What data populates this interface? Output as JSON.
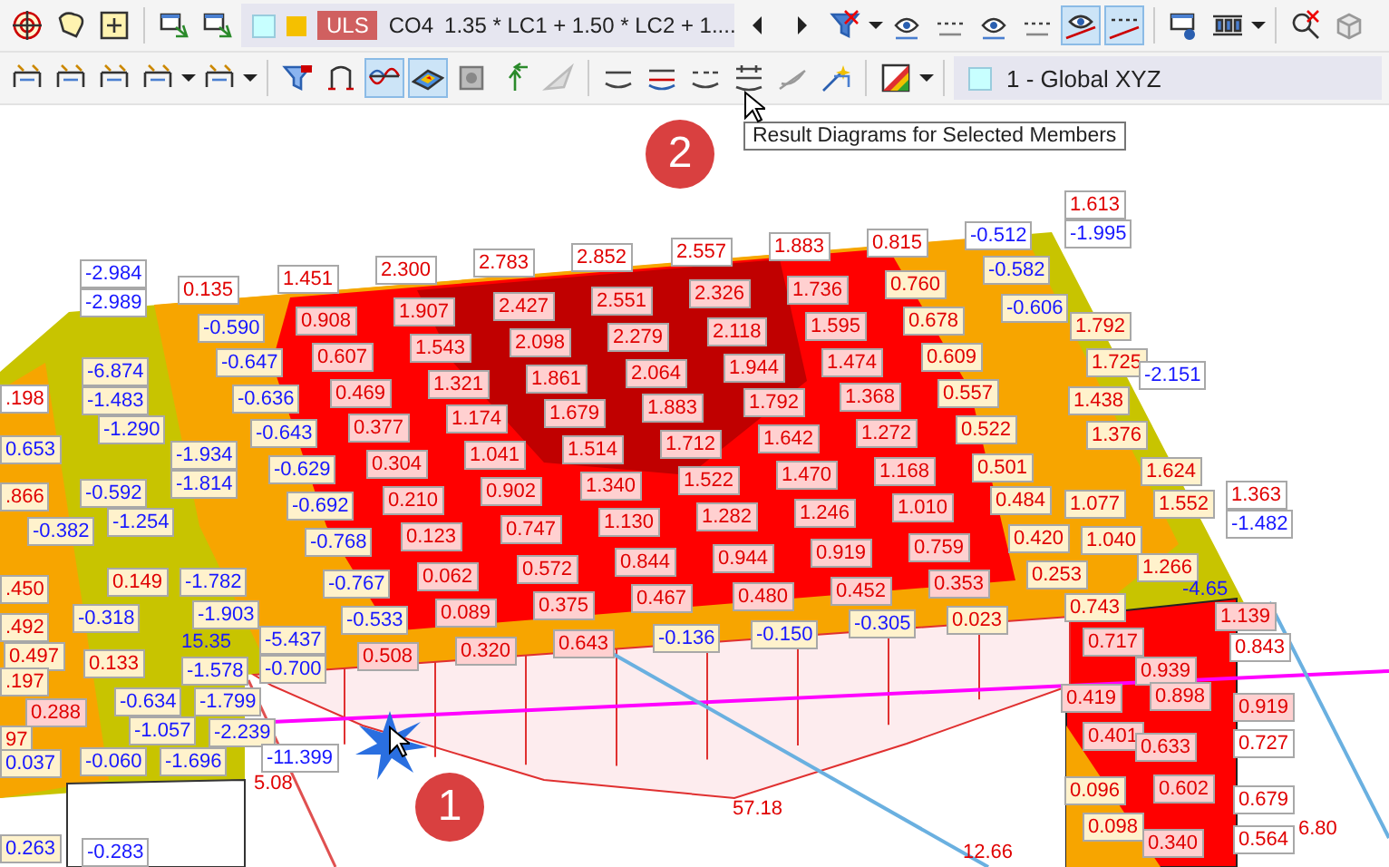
{
  "toolbar_top": {
    "buttons": [
      {
        "selected": false
      },
      {
        "selected": false
      },
      {
        "selected": false
      },
      {
        "selected": false
      },
      {
        "selected": false
      },
      {
        "selected": false
      },
      {
        "selected": false
      },
      {
        "selected": false
      },
      {
        "selected": false
      },
      {
        "selected": false
      },
      {
        "selected": false
      },
      {
        "selected": false
      },
      {
        "selected": true
      },
      {
        "selected": true
      },
      {
        "selected": false
      },
      {
        "selected": false
      },
      {
        "selected": false
      },
      {
        "selected": false
      }
    ],
    "load_combination": {
      "category": "ULS",
      "name": "CO4",
      "description": "1.35 * LC1 + 1.50 * LC2 + 1...."
    }
  },
  "toolbar_bottom": {
    "buttons": [
      {
        "selected": false
      },
      {
        "selected": false
      },
      {
        "selected": false
      },
      {
        "selected": false
      },
      {
        "selected": false
      },
      {
        "selected": false
      },
      {
        "selected": false
      },
      {
        "selected": true
      },
      {
        "selected": true
      },
      {
        "selected": false
      },
      {
        "selected": false
      },
      {
        "selected": false
      },
      {
        "selected": false
      },
      {
        "selected": false
      },
      {
        "selected": false
      },
      {
        "selected": false
      },
      {
        "selected": false
      },
      {
        "selected": false
      },
      {
        "selected": false
      }
    ],
    "coordinate_system": "1 - Global XYZ"
  },
  "tooltip": "Result Diagrams for Selected Members",
  "callouts": [
    "1",
    "2"
  ],
  "surface_labels": [
    {
      "text": "-2.984",
      "kind": "negative"
    },
    {
      "text": "-2.989",
      "kind": "negative"
    },
    {
      "text": "0.135",
      "kind": "positive"
    },
    {
      "text": "1.451",
      "kind": "positive"
    },
    {
      "text": "2.300",
      "kind": "positive"
    },
    {
      "text": "2.783",
      "kind": "positive"
    },
    {
      "text": "2.852",
      "kind": "positive"
    },
    {
      "text": "2.557",
      "kind": "positive"
    },
    {
      "text": "1.883",
      "kind": "positive"
    },
    {
      "text": "0.815",
      "kind": "positive"
    },
    {
      "text": "-0.512",
      "kind": "negative"
    },
    {
      "text": "1.613",
      "kind": "positive"
    },
    {
      "text": "-1.995",
      "kind": "negative"
    },
    {
      "text": "-0.590",
      "kind": "negative"
    },
    {
      "text": "0.908",
      "kind": "positive"
    },
    {
      "text": "1.907",
      "kind": "positive"
    },
    {
      "text": "2.427",
      "kind": "positive"
    },
    {
      "text": "2.551",
      "kind": "positive"
    },
    {
      "text": "2.326",
      "kind": "positive"
    },
    {
      "text": "1.736",
      "kind": "positive"
    },
    {
      "text": "0.760",
      "kind": "positive"
    },
    {
      "text": "-0.582",
      "kind": "negative"
    },
    {
      "text": "-0.647",
      "kind": "negative"
    },
    {
      "text": "0.607",
      "kind": "positive"
    },
    {
      "text": "1.543",
      "kind": "positive"
    },
    {
      "text": "2.098",
      "kind": "positive"
    },
    {
      "text": "2.279",
      "kind": "positive"
    },
    {
      "text": "2.118",
      "kind": "positive"
    },
    {
      "text": "1.595",
      "kind": "positive"
    },
    {
      "text": "0.678",
      "kind": "positive"
    },
    {
      "text": "-0.606",
      "kind": "negative"
    },
    {
      "text": "1.792",
      "kind": "positive"
    },
    {
      "text": "-6.874",
      "kind": "negative"
    },
    {
      "text": "-1.483",
      "kind": "negative"
    },
    {
      "text": "-0.636",
      "kind": "negative"
    },
    {
      "text": "0.469",
      "kind": "positive"
    },
    {
      "text": "1.321",
      "kind": "positive"
    },
    {
      "text": "1.861",
      "kind": "positive"
    },
    {
      "text": "2.064",
      "kind": "positive"
    },
    {
      "text": "1.944",
      "kind": "positive"
    },
    {
      "text": "1.474",
      "kind": "positive"
    },
    {
      "text": "0.609",
      "kind": "positive"
    },
    {
      "text": "1.725",
      "kind": "positive"
    },
    {
      "text": "-2.151",
      "kind": "negative"
    },
    {
      "text": "-1.290",
      "kind": "negative"
    },
    {
      "text": "-0.643",
      "kind": "negative"
    },
    {
      "text": "0.377",
      "kind": "positive"
    },
    {
      "text": "1.174",
      "kind": "positive"
    },
    {
      "text": "1.679",
      "kind": "positive"
    },
    {
      "text": "1.883",
      "kind": "positive"
    },
    {
      "text": "1.792",
      "kind": "positive"
    },
    {
      "text": "1.368",
      "kind": "positive"
    },
    {
      "text": "0.557",
      "kind": "positive"
    },
    {
      "text": "1.438",
      "kind": "positive"
    },
    {
      "text": "-1.934",
      "kind": "negative"
    },
    {
      "text": "-1.814",
      "kind": "negative"
    },
    {
      "text": "-0.629",
      "kind": "negative"
    },
    {
      "text": "0.304",
      "kind": "positive"
    },
    {
      "text": "1.041",
      "kind": "positive"
    },
    {
      "text": "1.514",
      "kind": "positive"
    },
    {
      "text": "1.712",
      "kind": "positive"
    },
    {
      "text": "1.642",
      "kind": "positive"
    },
    {
      "text": "1.272",
      "kind": "positive"
    },
    {
      "text": "0.522",
      "kind": "positive"
    },
    {
      "text": "1.376",
      "kind": "positive"
    },
    {
      "text": "1.624",
      "kind": "positive"
    },
    {
      "text": "1.363",
      "kind": "positive"
    },
    {
      "text": "-1.482",
      "kind": "negative"
    },
    {
      "text": "-0.592",
      "kind": "negative"
    },
    {
      "text": "-0.692",
      "kind": "negative"
    },
    {
      "text": "0.210",
      "kind": "positive"
    },
    {
      "text": "0.902",
      "kind": "positive"
    },
    {
      "text": "1.340",
      "kind": "positive"
    },
    {
      "text": "1.522",
      "kind": "positive"
    },
    {
      "text": "1.470",
      "kind": "positive"
    },
    {
      "text": "1.168",
      "kind": "positive"
    },
    {
      "text": "0.501",
      "kind": "positive"
    },
    {
      "text": "1.077",
      "kind": "positive"
    },
    {
      "text": "1.552",
      "kind": "positive"
    },
    {
      "text": "-0.382",
      "kind": "negative"
    },
    {
      "text": "-1.254",
      "kind": "negative"
    },
    {
      "text": "-0.768",
      "kind": "negative"
    },
    {
      "text": "0.123",
      "kind": "positive"
    },
    {
      "text": "0.747",
      "kind": "positive"
    },
    {
      "text": "1.130",
      "kind": "positive"
    },
    {
      "text": "1.282",
      "kind": "positive"
    },
    {
      "text": "1.246",
      "kind": "positive"
    },
    {
      "text": "1.010",
      "kind": "positive"
    },
    {
      "text": "0.484",
      "kind": "positive"
    },
    {
      "text": "1.040",
      "kind": "positive"
    },
    {
      "text": "1.266",
      "kind": "positive"
    },
    {
      "text": "0.149",
      "kind": "positive"
    },
    {
      "text": "-1.782",
      "kind": "negative"
    },
    {
      "text": "-0.767",
      "kind": "negative"
    },
    {
      "text": "0.062",
      "kind": "positive"
    },
    {
      "text": "0.572",
      "kind": "positive"
    },
    {
      "text": "0.844",
      "kind": "positive"
    },
    {
      "text": "0.944",
      "kind": "positive"
    },
    {
      "text": "0.919",
      "kind": "positive"
    },
    {
      "text": "0.759",
      "kind": "positive"
    },
    {
      "text": "0.420",
      "kind": "positive"
    },
    {
      "text": "-0.318",
      "kind": "negative"
    },
    {
      "text": "-1.903",
      "kind": "negative"
    },
    {
      "text": "-0.533",
      "kind": "negative"
    },
    {
      "text": "0.089",
      "kind": "positive"
    },
    {
      "text": "0.375",
      "kind": "positive"
    },
    {
      "text": "0.467",
      "kind": "positive"
    },
    {
      "text": "0.480",
      "kind": "positive"
    },
    {
      "text": "0.452",
      "kind": "positive"
    },
    {
      "text": "0.353",
      "kind": "positive"
    },
    {
      "text": "0.253",
      "kind": "positive"
    },
    {
      "text": "-5.437",
      "kind": "negative"
    },
    {
      "text": "-0.700",
      "kind": "negative"
    },
    {
      "text": "0.508",
      "kind": "positive"
    },
    {
      "text": "0.320",
      "kind": "positive"
    },
    {
      "text": "0.643",
      "kind": "positive"
    },
    {
      "text": "-0.136",
      "kind": "negative"
    },
    {
      "text": "-0.150",
      "kind": "negative"
    },
    {
      "text": "-0.305",
      "kind": "negative"
    },
    {
      "text": "0.023",
      "kind": "positive"
    },
    {
      "text": "0.743",
      "kind": "positive"
    },
    {
      "text": "1.139",
      "kind": "positive"
    },
    {
      "text": "0.133",
      "kind": "positive"
    },
    {
      "text": "-1.578",
      "kind": "negative"
    },
    {
      "text": "-0.634",
      "kind": "negative"
    },
    {
      "text": "-1.799",
      "kind": "negative"
    },
    {
      "text": "0.288",
      "kind": "positive"
    },
    {
      "text": "-1.057",
      "kind": "negative"
    },
    {
      "text": "-2.239",
      "kind": "negative"
    },
    {
      "text": "-1.696",
      "kind": "negative"
    },
    {
      "text": "-11.399",
      "kind": "negative"
    },
    {
      "text": "0.717",
      "kind": "positive"
    },
    {
      "text": "0.939",
      "kind": "positive"
    },
    {
      "text": "0.843",
      "kind": "positive"
    },
    {
      "text": "0.419",
      "kind": "positive"
    },
    {
      "text": "0.898",
      "kind": "positive"
    },
    {
      "text": "0.919",
      "kind": "positive"
    },
    {
      "text": "0.401",
      "kind": "positive"
    },
    {
      "text": "0.633",
      "kind": "positive"
    },
    {
      "text": "0.727",
      "kind": "positive"
    },
    {
      "text": "0.096",
      "kind": "positive"
    },
    {
      "text": "0.602",
      "kind": "positive"
    },
    {
      "text": "0.679",
      "kind": "positive"
    },
    {
      "text": "0.098",
      "kind": "positive"
    },
    {
      "text": "0.340",
      "kind": "positive"
    },
    {
      "text": "0.564",
      "kind": "positive"
    },
    {
      "text": "-0.283",
      "kind": "negative"
    },
    {
      "text": ".198",
      "kind": "positive"
    },
    {
      "text": "0.653",
      "kind": "negative"
    },
    {
      "text": ".866",
      "kind": "positive"
    },
    {
      "text": ".450",
      "kind": "positive"
    },
    {
      "text": ".492",
      "kind": "positive"
    },
    {
      "text": "0.497",
      "kind": "positive"
    },
    {
      "text": ".197",
      "kind": "positive"
    },
    {
      "text": "97",
      "kind": "positive"
    },
    {
      "text": "0.037",
      "kind": "negative"
    },
    {
      "text": "-0.060",
      "kind": "negative"
    },
    {
      "text": "0.263",
      "kind": "negative"
    }
  ],
  "member_labels": [
    {
      "text": "15.35",
      "kind": "negative"
    },
    {
      "text": "-4.65",
      "kind": "negative"
    },
    {
      "text": "5.08",
      "kind": "positive"
    },
    {
      "text": "57.18",
      "kind": "positive"
    },
    {
      "text": "12.66",
      "kind": "positive"
    },
    {
      "text": "6.80",
      "kind": "positive"
    }
  ]
}
